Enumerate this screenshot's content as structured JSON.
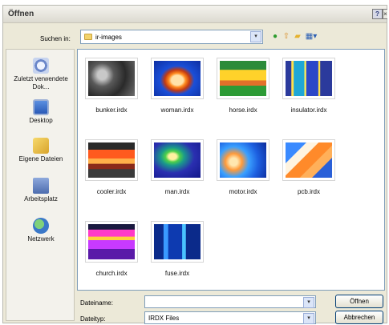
{
  "window": {
    "title": "Öffnen"
  },
  "titlebar": {
    "help_label": "?",
    "close_label": "×"
  },
  "lookin": {
    "label": "Suchen in:",
    "value": "ir-images",
    "arrow": "▾"
  },
  "toolbar_icons": [
    "back-icon",
    "up-folder-icon",
    "new-folder-icon",
    "views-menu-icon"
  ],
  "places": [
    {
      "label": "Zuletzt verwendete Dok...",
      "icon": "recent-documents-icon"
    },
    {
      "label": "Desktop",
      "icon": "desktop-icon"
    },
    {
      "label": "Eigene Dateien",
      "icon": "my-documents-icon"
    },
    {
      "label": "Arbeitsplatz",
      "icon": "my-computer-icon"
    },
    {
      "label": "Netzwerk",
      "icon": "network-icon"
    }
  ],
  "files": [
    {
      "name": "bunker.irdx"
    },
    {
      "name": "woman.irdx"
    },
    {
      "name": "horse.irdx"
    },
    {
      "name": "insulator.irdx"
    },
    {
      "name": "cooler.irdx"
    },
    {
      "name": "man.irdx"
    },
    {
      "name": "motor.irdx"
    },
    {
      "name": "pcb.irdx"
    },
    {
      "name": "church.irdx"
    },
    {
      "name": "fuse.irdx"
    }
  ],
  "footer": {
    "filename_label": "Dateiname:",
    "filename_value": "",
    "filetype_label": "Dateityp:",
    "filetype_value": "IRDX Files",
    "open_button": "Öffnen",
    "cancel_button": "Abbrechen"
  }
}
